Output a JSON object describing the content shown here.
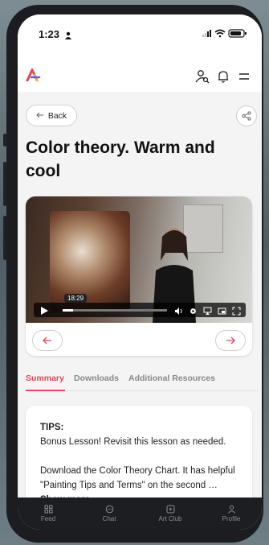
{
  "status": {
    "time": "1:23"
  },
  "toolbar": {
    "back_label": "Back"
  },
  "lesson": {
    "title": "Color theory. Warm and cool"
  },
  "video": {
    "timestamp": "18:29",
    "progress": 0.1
  },
  "tabs": [
    {
      "label": "Summary",
      "active": true
    },
    {
      "label": "Downloads",
      "active": false
    },
    {
      "label": "Additional Resources",
      "active": false
    }
  ],
  "tips": {
    "title": "TIPS:",
    "line1": "Bonus Lesson! Revisit this lesson as needed.",
    "line2": "Download the Color Theory Chart. It has helpful \"Painting Tips and Terms\" on the second …",
    "show_more": "Show more"
  },
  "bottom_nav": [
    {
      "label": "Feed",
      "icon": "grid-icon"
    },
    {
      "label": "Chat",
      "icon": "chat-icon"
    },
    {
      "label": "Art Club",
      "icon": "play-square-icon"
    },
    {
      "label": "Profile",
      "icon": "user-icon"
    }
  ],
  "colors": {
    "accent": "#e4475a",
    "nav_bg": "#1d1e21",
    "screen_bg": "#f4f4f5"
  }
}
